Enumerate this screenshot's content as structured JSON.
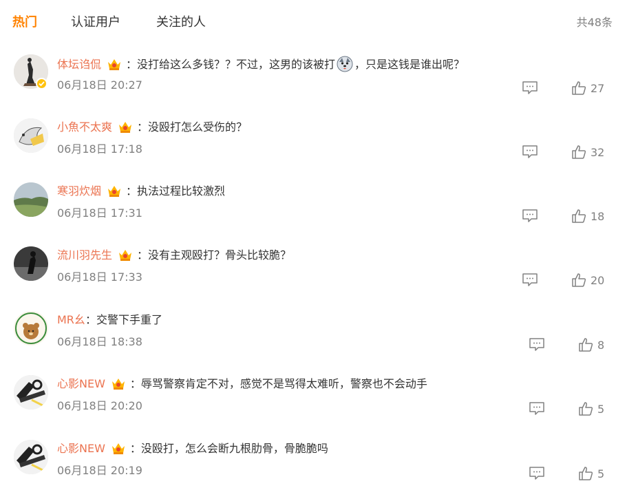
{
  "tabs": [
    {
      "label": "热门",
      "active": true
    },
    {
      "label": "认证用户",
      "active": false
    },
    {
      "label": "关注的人",
      "active": false
    }
  ],
  "total_count": "共48条",
  "colors": {
    "accent": "#ff8200",
    "username": "#eb7350",
    "meta": "#808080",
    "text": "#333333"
  },
  "comments": [
    {
      "user": "体坛诌侃",
      "sep": "：",
      "text_a": "没打给这么多钱？？不过，这男的该被打",
      "emoji": "husky-emoji",
      "text_b": "，只是这钱是谁出呢？",
      "time": "06月18日 20:27",
      "likes": "27",
      "verified": true,
      "crown": true
    },
    {
      "user": "小魚不太爽",
      "sep": "：",
      "text_a": "没殴打怎么受伤的？",
      "time": "06月18日 17:18",
      "likes": "32",
      "verified": false,
      "crown": true
    },
    {
      "user": "寒羽炊烟",
      "sep": "：",
      "text_a": "执法过程比较激烈",
      "time": "06月18日 17:31",
      "likes": "18",
      "verified": false,
      "crown": true
    },
    {
      "user": "流川羽先生",
      "sep": "：",
      "text_a": "没有主观殴打？骨头比较脆？",
      "time": "06月18日 17:33",
      "likes": "20",
      "verified": false,
      "crown": true
    },
    {
      "user": "MR幺",
      "sep": "：",
      "text_a": "交警下手重了",
      "time": "06月18日 18:38",
      "likes": "8",
      "verified": false,
      "crown": false
    },
    {
      "user": "心影NEW",
      "sep": "：",
      "text_a": "辱骂警察肯定不对，感觉不是骂得太难听，警察也不会动手",
      "time": "06月18日 20:20",
      "likes": "5",
      "verified": false,
      "crown": true
    },
    {
      "user": "心影NEW",
      "sep": "：",
      "text_a": "没殴打，怎么会断九根肋骨，骨脆脆吗",
      "time": "06月18日 20:19",
      "likes": "5",
      "verified": false,
      "crown": true
    }
  ]
}
